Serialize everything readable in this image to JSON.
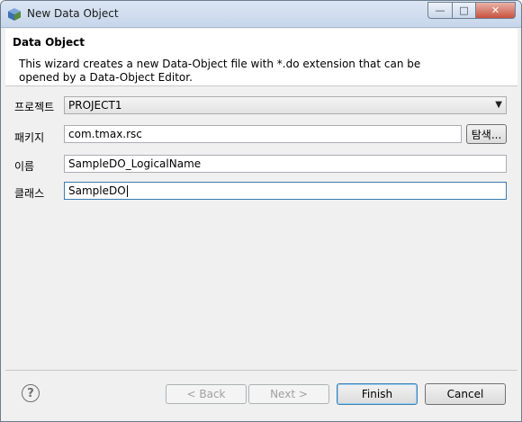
{
  "window": {
    "title": "New Data Object",
    "minimize_glyph": "—",
    "maximize_glyph": "□",
    "close_glyph": "✕"
  },
  "header": {
    "title": "Data Object",
    "description": "This wizard creates a new Data-Object file with *.do extension that can be opened by a Data-Object Editor."
  },
  "form": {
    "project_label": "프로젝트",
    "project_value": "PROJECT1",
    "package_label": "패키지",
    "package_value": "com.tmax.rsc",
    "browse_label": "탐색...",
    "name_label": "이름",
    "name_value": "SampleDO_LogicalName",
    "class_label": "클래스",
    "class_value": "SampleDO"
  },
  "footer": {
    "help_glyph": "?",
    "back_label": "< Back",
    "next_label": "Next >",
    "finish_label": "Finish",
    "cancel_label": "Cancel"
  }
}
